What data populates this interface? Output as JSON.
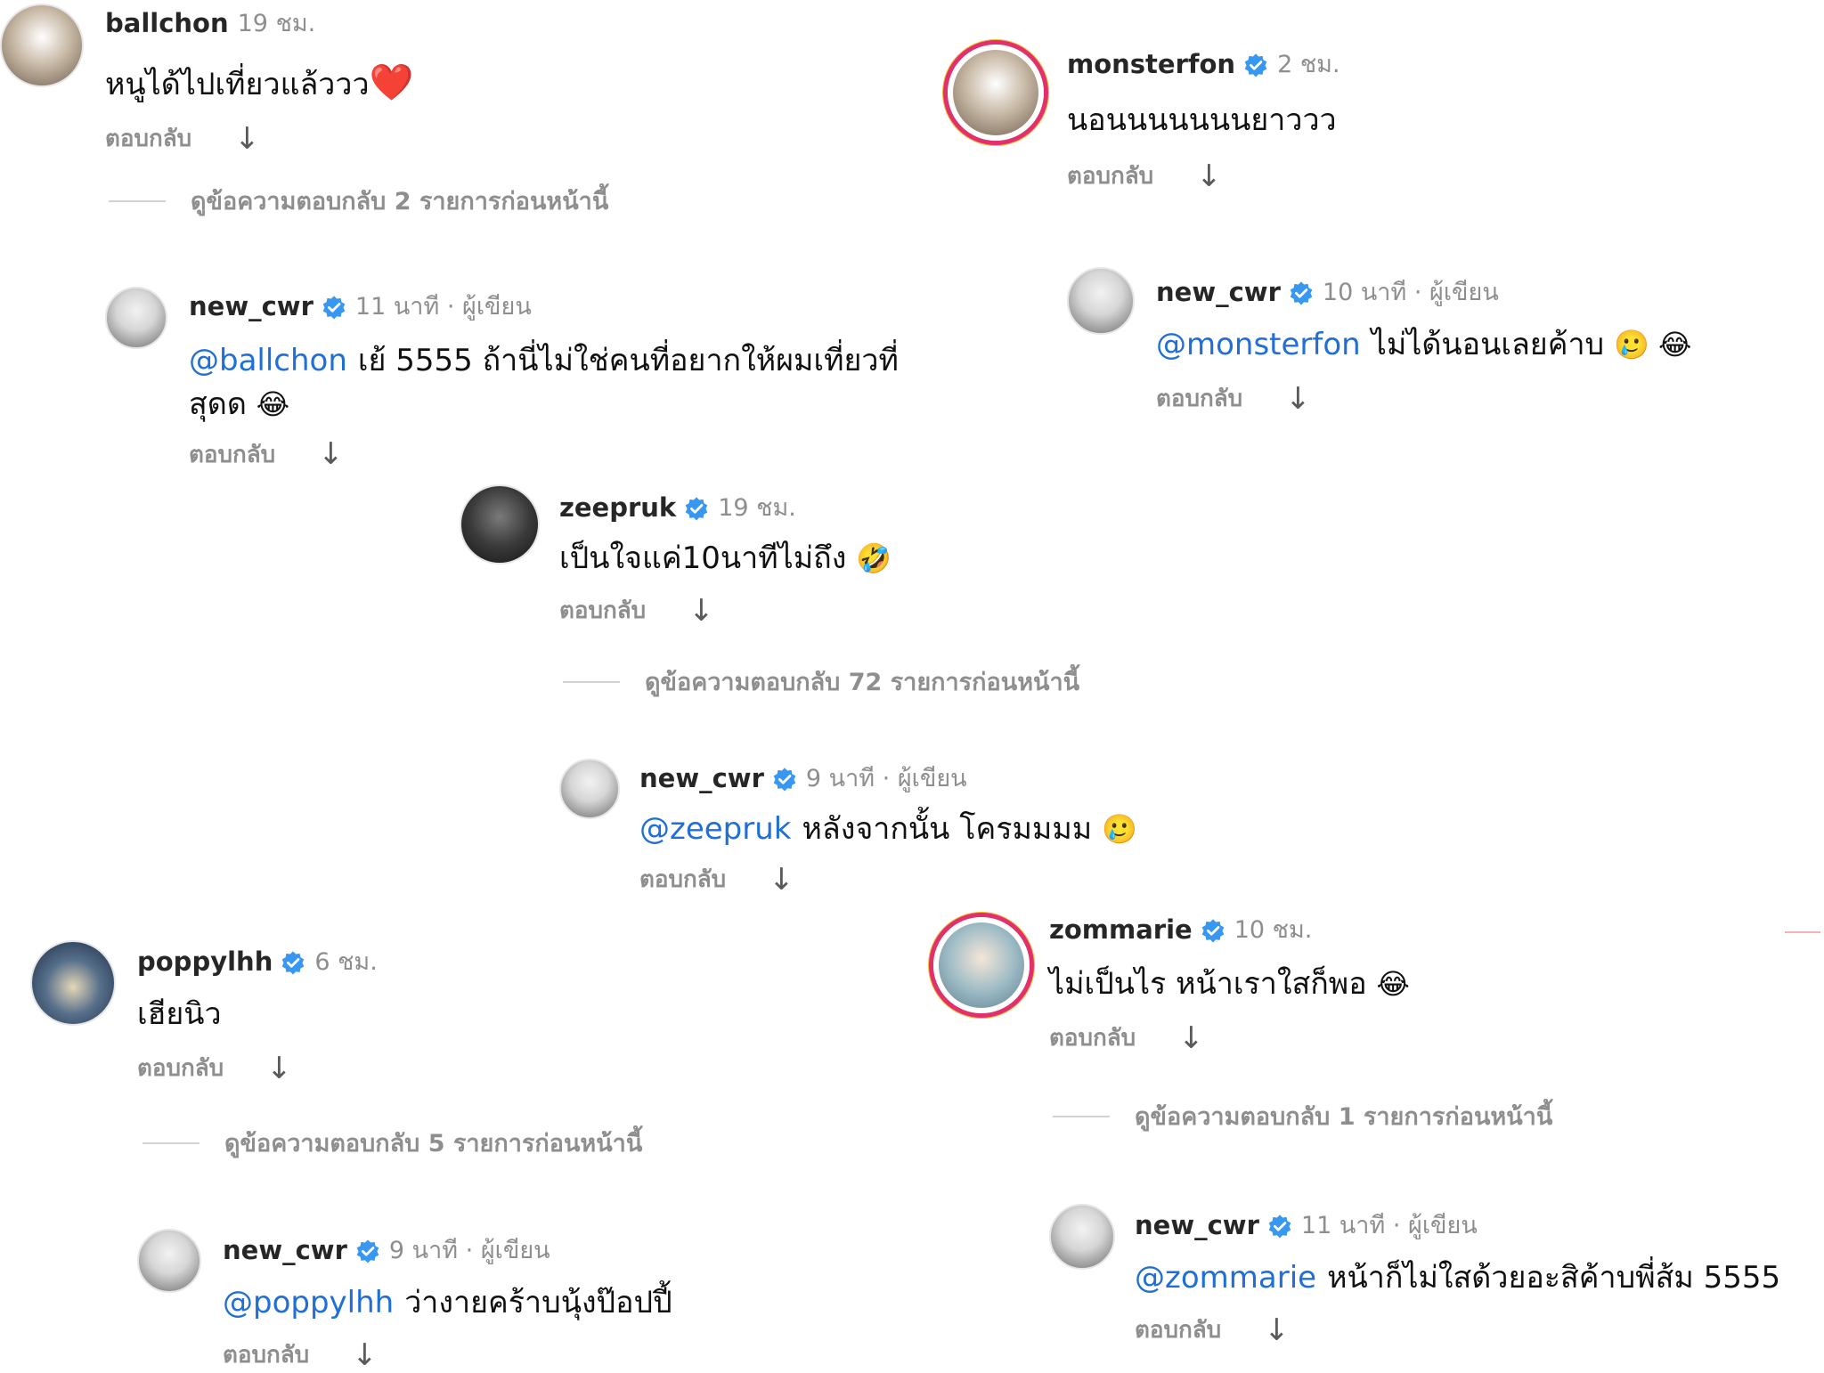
{
  "labels": {
    "reply": "ตอบกลับ",
    "arrow": "↓"
  },
  "comments": [
    {
      "id": "ballchon",
      "username": "ballchon",
      "time": "19 ชม.",
      "text": "หนูได้ไปเที่ยวแล้ววว",
      "emoji": "❤️",
      "verified": false
    },
    {
      "id": "new_cwr_1",
      "username": "new_cwr",
      "time": "11 นาที · ผู้เขียน",
      "mention": "@ballchon",
      "text": "เย้ 5555 ถ้านี่ไม่ใช่คนที่อยากให้ผมเที่ยวที่",
      "text2": "สุดด",
      "emoji": "😂",
      "verified": true
    },
    {
      "id": "zeepruk",
      "username": "zeepruk",
      "time": "19 ชม.",
      "text": "เป็นใจแค่10นาทีไม่ถึง",
      "emoji": "🤣",
      "verified": true
    },
    {
      "id": "new_cwr_2",
      "username": "new_cwr",
      "time": "9 นาที · ผู้เขียน",
      "mention": "@zeepruk",
      "text": "หลังจากนั้น โครมมมม",
      "emoji": "🥲",
      "verified": true
    },
    {
      "id": "poppylhh",
      "username": "poppylhh",
      "time": "6 ชม.",
      "text": "เฮียนิว",
      "verified": true
    },
    {
      "id": "new_cwr_3",
      "username": "new_cwr",
      "time": "9 นาที · ผู้เขียน",
      "mention": "@poppylhh",
      "text": "ว่างายคร้าบนุ้งป๊อปปี้",
      "verified": true
    },
    {
      "id": "monsterfon",
      "username": "monsterfon",
      "time": "2 ชม.",
      "text": "นอนนนนนนนยาววว",
      "verified": true
    },
    {
      "id": "new_cwr_4",
      "username": "new_cwr",
      "time": "10 นาที · ผู้เขียน",
      "mention": "@monsterfon",
      "text": "ไม่ได้นอนเลยค้าบ",
      "emoji": "🥲 😂",
      "verified": true
    },
    {
      "id": "zommarie",
      "username": "zommarie",
      "time": "10 ชม.",
      "text": "ไม่เป็นไร หน้าเราใสก็พอ",
      "emoji": "😂",
      "verified": true
    },
    {
      "id": "new_cwr_5",
      "username": "new_cwr",
      "time": "11 นาที · ผู้เขียน",
      "mention": "@zommarie",
      "text": "หน้าก็ไม่ใสด้วยอะสิค้าบพี่ส้ม 5555",
      "verified": true
    }
  ],
  "view_more": {
    "v1": "ดูข้อความตอบกลับ 2 รายการก่อนหน้านี้",
    "v2": "ดูข้อความตอบกลับ 72 รายการก่อนหน้านี้",
    "v3": "ดูข้อความตอบกลับ 5 รายการก่อนหน้านี้",
    "v4": "ดูข้อความตอบกลับ 1 รายการก่อนหน้านี้"
  }
}
